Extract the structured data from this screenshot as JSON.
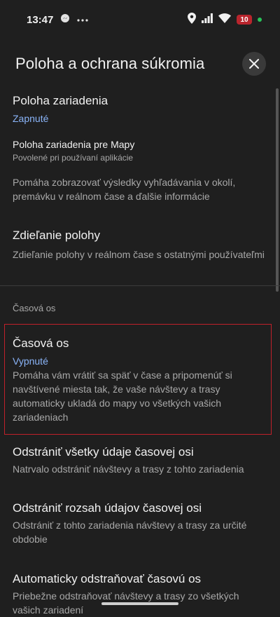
{
  "status_bar": {
    "time": "13:47",
    "battery": "10"
  },
  "header": {
    "title": "Poloha a ochrana súkromia"
  },
  "items": [
    {
      "title": "Poloha zariadenia",
      "value": "Zapnuté"
    },
    {
      "title": "Poloha zariadenia pre Mapy",
      "subtitle": "Povolené pri používaní aplikácie",
      "description": "Pomáha zobrazovať výsledky vyhľadávania v okolí, premávku v reálnom čase a ďalšie informácie"
    },
    {
      "title": "Zdieľanie polohy",
      "subtitle": "Zdieľanie polohy v reálnom čase s ostatnými používateľmi"
    }
  ],
  "section": {
    "label": "Časová os"
  },
  "timeline": {
    "title": "Časová os",
    "value": "Vypnuté",
    "description": "Pomáha vám vrátiť sa späť v čase a pripomenúť si navštívené miesta tak, že vaše návštevy a trasy automaticky ukladá do mapy vo všetkých vašich zariadeniach"
  },
  "actions": [
    {
      "title": "Odstrániť všetky údaje časovej osi",
      "subtitle": "Natrvalo odstrániť návštevy a trasy z tohto zariadenia"
    },
    {
      "title": "Odstrániť rozsah údajov časovej osi",
      "subtitle": "Odstrániť z tohto zariadenia návštevy a trasy za určité obdobie"
    },
    {
      "title": "Automaticky odstraňovať časovú os",
      "subtitle": "Priebežne odstraňovať návštevy a trasy zo všetkých vašich zariadení"
    }
  ],
  "colors": {
    "accent": "#8ab4f8",
    "highlight": "#c0202a",
    "background": "#1f1f1f"
  }
}
